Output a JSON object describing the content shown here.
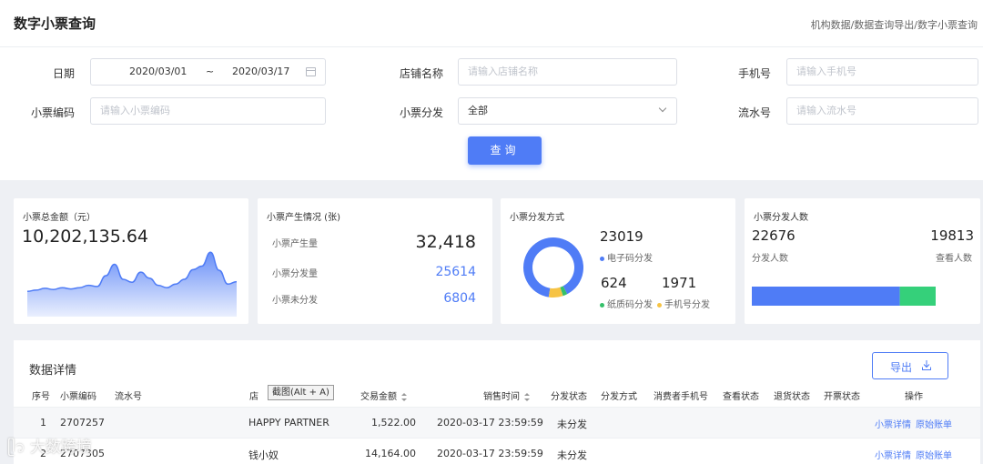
{
  "header": {
    "title": "数字小票查询",
    "breadcrumb": "机构数据/数据查询导出/数字小票查询"
  },
  "filters": {
    "date": {
      "label": "日期",
      "start": "2020/03/01",
      "sep": "~",
      "end": "2020/03/17"
    },
    "store": {
      "label": "店铺名称",
      "placeholder": "请输入店铺名称"
    },
    "phone": {
      "label": "手机号",
      "placeholder": "请输入手机号"
    },
    "ticket_code": {
      "label": "小票编码",
      "placeholder": "请输入小票编码"
    },
    "dist": {
      "label": "小票分发",
      "value": "全部"
    },
    "serial": {
      "label": "流水号",
      "placeholder": "请输入流水号"
    },
    "query_label": "查询"
  },
  "cards": {
    "total": {
      "title": "小票总金额（元）",
      "value": "10,202,135.64"
    },
    "production": {
      "title": "小票产生情况 (张)",
      "rows": [
        {
          "label": "小票产生量",
          "value": "32,418"
        },
        {
          "label": "小票分发量",
          "value": "25614"
        },
        {
          "label": "小票未分发",
          "value": "6804"
        }
      ]
    },
    "method": {
      "title": "小票分发方式",
      "electronic": {
        "value": "23019",
        "label": "电子码分发"
      },
      "paper": {
        "value": "624",
        "label": "纸质码分发"
      },
      "phone": {
        "value": "1971",
        "label": "手机号分发"
      }
    },
    "people": {
      "title": "小票分发人数",
      "dist_value": "22676",
      "dist_label": "分发人数",
      "view_value": "19813",
      "view_label": "查看人数"
    }
  },
  "details": {
    "title": "数据详情",
    "export_label": "导出",
    "tooltip": "截图(Alt + A)",
    "headers": {
      "idx": "序号",
      "code": "小票编码",
      "serial": "流水号",
      "store_prefix": "店",
      "amount": "交易金额",
      "time": "销售时间",
      "status": "分发状态",
      "method": "分发方式",
      "phone": "消费者手机号",
      "view": "查看状态",
      "refund": "退货状态",
      "invoice": "开票状态",
      "op": "操作"
    },
    "rows": [
      {
        "idx": "1",
        "code": "2707257",
        "store": "HAPPY PARTNER",
        "amount": "1,522.00",
        "time": "2020-03-17 23:59:59",
        "status": "未分发",
        "op1": "小票详情",
        "op2": "原始账单"
      },
      {
        "idx": "2",
        "code": "2707305",
        "store": "钱小奴",
        "amount": "14,164.00",
        "time": "2020-03-17 23:59:59",
        "status": "未分发",
        "op1": "小票详情",
        "op2": "原始账单"
      }
    ]
  },
  "watermark": "大数跨境",
  "chart_data": [
    {
      "type": "area",
      "title": "小票总金额（元）",
      "x": [
        0,
        1,
        2,
        3,
        4,
        5,
        6,
        7,
        8,
        9,
        10,
        11,
        12,
        13,
        14,
        15,
        16,
        17,
        18,
        19,
        20,
        21,
        22,
        23,
        24
      ],
      "values": [
        0.3,
        0.32,
        0.35,
        0.33,
        0.36,
        0.34,
        0.36,
        0.4,
        0.38,
        0.56,
        0.75,
        0.5,
        0.45,
        0.62,
        0.52,
        0.4,
        0.36,
        0.42,
        0.5,
        0.66,
        0.72,
        0.95,
        0.65,
        0.42,
        0.46
      ],
      "colors": [
        "#4f7cf6"
      ]
    },
    {
      "type": "pie",
      "title": "小票分发方式",
      "categories": [
        "电子码分发",
        "纸质码分发",
        "手机号分发"
      ],
      "values": [
        23019,
        624,
        1971
      ],
      "colors": [
        "#4f7cf6",
        "#35c06a",
        "#f6c344"
      ],
      "note_color_paper": "#35c06a"
    },
    {
      "type": "bar",
      "title": "小票分发人数",
      "categories": [
        "分发人数",
        "查看人数"
      ],
      "values": [
        22676,
        19813
      ],
      "colors": [
        "#4f7cf6",
        "#35d07a"
      ]
    }
  ]
}
